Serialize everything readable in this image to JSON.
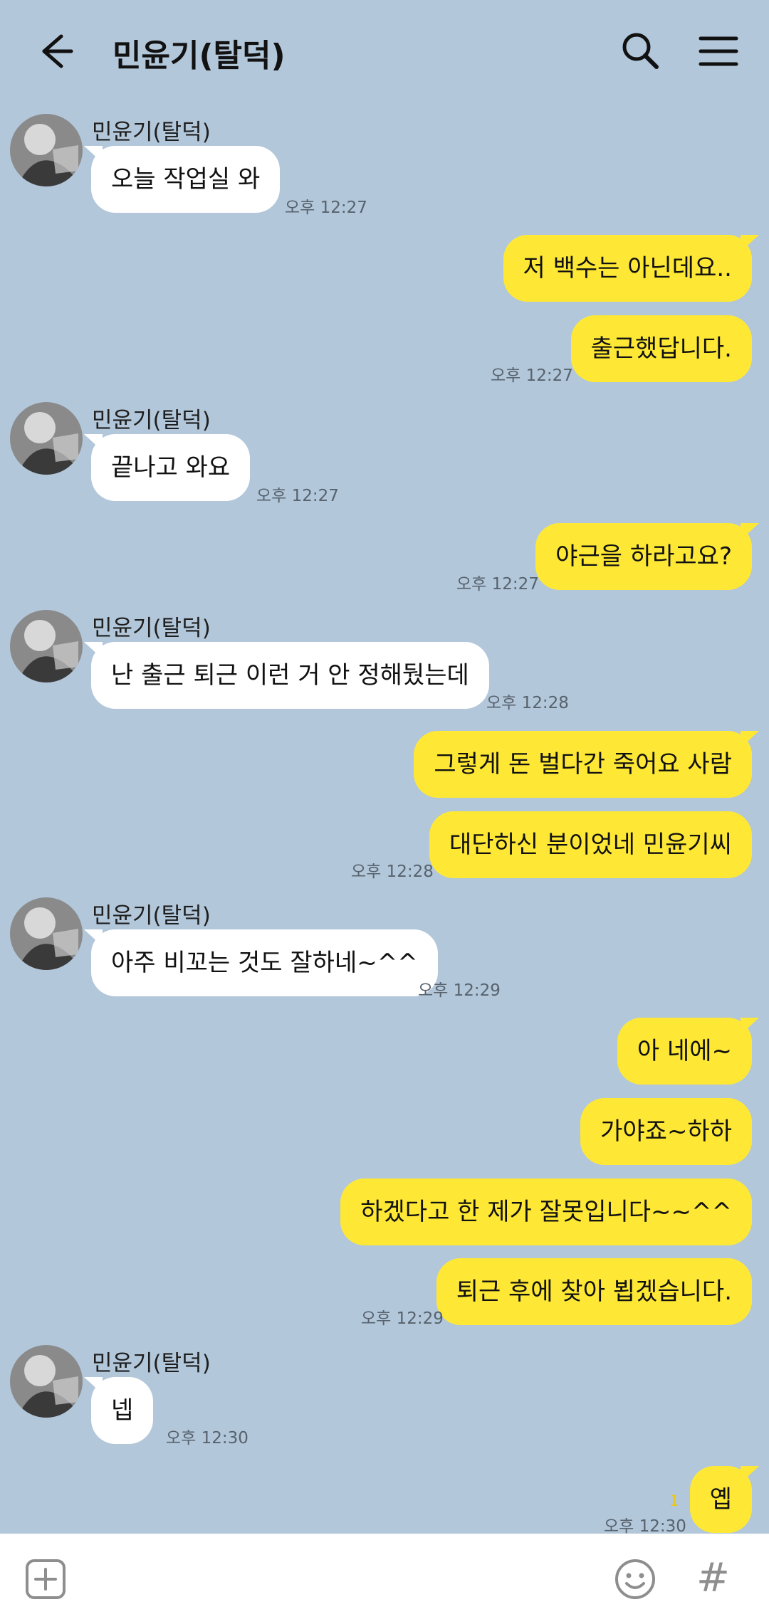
{
  "header": {
    "title": "민윤기(탈덕)",
    "back_icon": "arrow-left-icon",
    "search_icon": "search-icon",
    "menu_icon": "hamburger-menu-icon"
  },
  "messages": [
    {
      "sender": "민윤기(탈덕)",
      "direction": "in",
      "text": "오늘 작업실 와",
      "time": "오후 12:27"
    },
    {
      "direction": "out",
      "text": "저 백수는 아닌데요.."
    },
    {
      "direction": "out",
      "text": "출근했답니다.",
      "time": "오후 12:27"
    },
    {
      "sender": "민윤기(탈덕)",
      "direction": "in",
      "text": "끝나고 와요",
      "time": "오후 12:27"
    },
    {
      "direction": "out",
      "text": "야근을 하라고요?",
      "time": "오후 12:27"
    },
    {
      "sender": "민윤기(탈덕)",
      "direction": "in",
      "text": "난 출근 퇴근 이런 거 안 정해뒀는데",
      "time": "오후 12:28"
    },
    {
      "direction": "out",
      "text": "그렇게 돈 벌다간 죽어요 사람"
    },
    {
      "direction": "out",
      "text": "대단하신 분이었네 민윤기씨",
      "time": "오후 12:28"
    },
    {
      "sender": "민윤기(탈덕)",
      "direction": "in",
      "text": "아주 비꼬는 것도 잘하네~^^",
      "time": "오후 12:29"
    },
    {
      "direction": "out",
      "text": "아 네에~"
    },
    {
      "direction": "out",
      "text": "가야죠~하하"
    },
    {
      "direction": "out",
      "text": "하겠다고 한 제가 잘못입니다~~^^"
    },
    {
      "direction": "out",
      "text": "퇴근 후에 찾아 뵙겠습니다.",
      "time": "오후 12:29"
    },
    {
      "sender": "민윤기(탈덕)",
      "direction": "in",
      "text": "넵",
      "time": "오후 12:30"
    },
    {
      "direction": "out",
      "text": "옙",
      "time": "오후 12:30",
      "unread": "1"
    }
  ],
  "input_bar": {
    "plus_icon": "plus-box-icon",
    "emoji_icon": "emoji-icon",
    "hash_icon": "hashtag-icon",
    "hash_symbol": "#"
  },
  "colors": {
    "background": "#b2c7da",
    "my_bubble": "#fee835",
    "their_bubble": "#ffffff"
  }
}
